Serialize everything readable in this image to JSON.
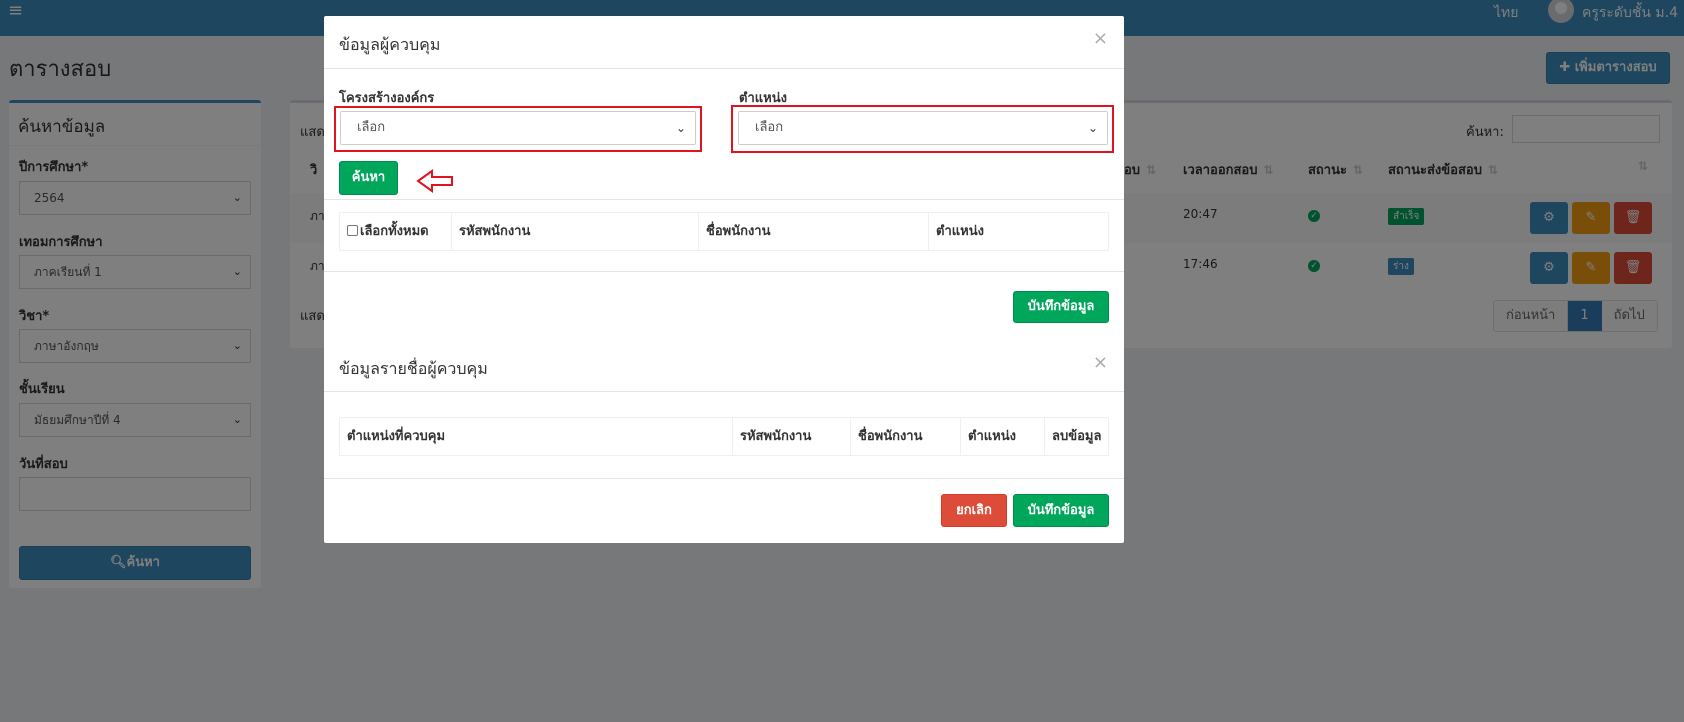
{
  "topbar": {
    "menu_icon": "hamburger-icon",
    "language": "ไทย",
    "user_name": "ครูระดับชั้น ม.4",
    "color": "#3c8dbc"
  },
  "page": {
    "title": "ตารางสอบ",
    "add_button": "เพิ่มตารางสอบ"
  },
  "search_panel": {
    "title": "ค้นหาข้อมูล",
    "year_label": "ปีการศึกษา*",
    "year_value": "2564",
    "term_label": "เทอมการศึกษา",
    "term_value": "ภาคเรียนที่ 1",
    "subject_label": "วิชา*",
    "subject_value": "ภาษาอังกฤษ",
    "level_label": "ชั้นเรียน",
    "level_value": "มัธยมศึกษาปีที่ 4",
    "date_label": "วันที่สอบ",
    "date_value": "",
    "search_button": "ค้นหา"
  },
  "main_table": {
    "show_prefix": "แสด",
    "filter_label": "ค้นหา:",
    "headers": {
      "subject": "วิ",
      "start": "อบ",
      "end": "เวลาออกสอบ",
      "status": "สถานะ",
      "submit_status": "สถานะส่งข้อสอบ"
    },
    "rows": [
      {
        "subject": "ภา",
        "end_time": "20:47",
        "status_icon": "check-circle-icon",
        "badge": "สำเร็จ",
        "badge_color": "#00a65a"
      },
      {
        "subject": "ภา",
        "end_time": "17:46",
        "status_icon": "check-circle-icon",
        "badge": "ร่าง",
        "badge_color": "#3c8dbc"
      }
    ],
    "bottom_show": "แสด",
    "pager": {
      "prev": "ก่อนหน้า",
      "current": "1",
      "next": "ถัดไป"
    },
    "action_colors": {
      "settings": "#3c8dbc",
      "edit": "#f39c12",
      "delete": "#dd4b39"
    }
  },
  "modal": {
    "title": "ข้อมูลผู้ควบคุม",
    "close": "×",
    "org_label": "โครงสร้างองค์กร",
    "org_value": "เลือก",
    "position_label": "ตำแหน่ง",
    "position_value": "เลือก",
    "search_button": "ค้นหา",
    "table_headers": {
      "select_all": "เลือกทั้งหมด",
      "emp_code": "รหัสพนักงาน",
      "emp_name": "ชื่อพนักงาน",
      "position": "ตำแหน่ง"
    },
    "save_button": "บันทึกข้อมูล",
    "list_title": "ข้อมูลรายชื่อผู้ควบคุม",
    "list_close": "×",
    "list_headers": {
      "control_position": "ตำแหน่งที่ควบคุม",
      "emp_code": "รหัสพนักงาน",
      "emp_name": "ชื่อพนักงาน",
      "position": "ตำแหน่ง",
      "delete": "ลบข้อมูล"
    },
    "cancel_button": "ยกเลิก",
    "save_button_bottom": "บันทึกข้อมูล",
    "highlight_color": "#e0141e"
  }
}
